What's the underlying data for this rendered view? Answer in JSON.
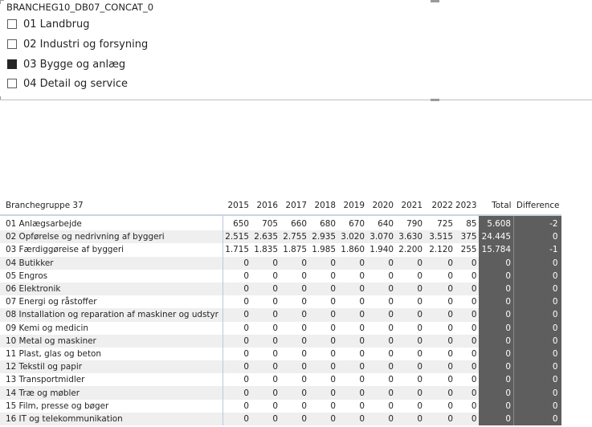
{
  "slicer": {
    "title": "BRANCHEG10_DB07_CONCAT_0",
    "items": [
      {
        "label": "01 Landbrug",
        "checked": false
      },
      {
        "label": "02 Industri og forsyning",
        "checked": false
      },
      {
        "label": "03 Bygge og anlæg",
        "checked": true
      },
      {
        "label": "04 Detail og service",
        "checked": false
      }
    ]
  },
  "matrix": {
    "headers": {
      "row_header": "Branchegruppe 37",
      "years": [
        "2015",
        "2016",
        "2017",
        "2018",
        "2019",
        "2020",
        "2021",
        "2022",
        "2023"
      ],
      "total": "Total",
      "difference": "Difference"
    },
    "rows": [
      {
        "label": "01 Anlægsarbejde",
        "values": [
          "650",
          "705",
          "660",
          "680",
          "670",
          "640",
          "790",
          "725",
          "85"
        ],
        "total": "5.608",
        "diff": "-2"
      },
      {
        "label": "02 Opførelse og nedrivning af byggeri",
        "values": [
          "2.515",
          "2.635",
          "2.755",
          "2.935",
          "3.020",
          "3.070",
          "3.630",
          "3.515",
          "375"
        ],
        "total": "24.445",
        "diff": "0"
      },
      {
        "label": "03 Færdiggøreise af byggeri",
        "values": [
          "1.715",
          "1.835",
          "1.875",
          "1.985",
          "1.860",
          "1.940",
          "2.200",
          "2.120",
          "255"
        ],
        "total": "15.784",
        "diff": "-1"
      },
      {
        "label": "04 Butikker",
        "values": [
          "0",
          "0",
          "0",
          "0",
          "0",
          "0",
          "0",
          "0",
          "0"
        ],
        "total": "0",
        "diff": "0"
      },
      {
        "label": "05 Engros",
        "values": [
          "0",
          "0",
          "0",
          "0",
          "0",
          "0",
          "0",
          "0",
          "0"
        ],
        "total": "0",
        "diff": "0"
      },
      {
        "label": "06 Elektronik",
        "values": [
          "0",
          "0",
          "0",
          "0",
          "0",
          "0",
          "0",
          "0",
          "0"
        ],
        "total": "0",
        "diff": "0"
      },
      {
        "label": "07 Energi og råstoffer",
        "values": [
          "0",
          "0",
          "0",
          "0",
          "0",
          "0",
          "0",
          "0",
          "0"
        ],
        "total": "0",
        "diff": "0"
      },
      {
        "label": "08 Installation og reparation af maskiner og udstyr",
        "values": [
          "0",
          "0",
          "0",
          "0",
          "0",
          "0",
          "0",
          "0",
          "0"
        ],
        "total": "0",
        "diff": "0"
      },
      {
        "label": "09 Kemi og medicin",
        "values": [
          "0",
          "0",
          "0",
          "0",
          "0",
          "0",
          "0",
          "0",
          "0"
        ],
        "total": "0",
        "diff": "0"
      },
      {
        "label": "10 Metal og maskiner",
        "values": [
          "0",
          "0",
          "0",
          "0",
          "0",
          "0",
          "0",
          "0",
          "0"
        ],
        "total": "0",
        "diff": "0"
      },
      {
        "label": "11 Plast, glas og beton",
        "values": [
          "0",
          "0",
          "0",
          "0",
          "0",
          "0",
          "0",
          "0",
          "0"
        ],
        "total": "0",
        "diff": "0"
      },
      {
        "label": "12 Tekstil og papir",
        "values": [
          "0",
          "0",
          "0",
          "0",
          "0",
          "0",
          "0",
          "0",
          "0"
        ],
        "total": "0",
        "diff": "0"
      },
      {
        "label": "13 Transportmidler",
        "values": [
          "0",
          "0",
          "0",
          "0",
          "0",
          "0",
          "0",
          "0",
          "0"
        ],
        "total": "0",
        "diff": "0"
      },
      {
        "label": "14 Træ og møbler",
        "values": [
          "0",
          "0",
          "0",
          "0",
          "0",
          "0",
          "0",
          "0",
          "0"
        ],
        "total": "0",
        "diff": "0"
      },
      {
        "label": "15 Film, presse og bøger",
        "values": [
          "0",
          "0",
          "0",
          "0",
          "0",
          "0",
          "0",
          "0",
          "0"
        ],
        "total": "0",
        "diff": "0"
      },
      {
        "label": "16 IT og telekommunikation",
        "values": [
          "0",
          "0",
          "0",
          "0",
          "0",
          "0",
          "0",
          "0",
          "0"
        ],
        "total": "0",
        "diff": "0"
      }
    ]
  },
  "colors": {
    "total_bg": "#5e5e5e",
    "alt_row_bg": "#efefef",
    "checked_box": "#252423"
  }
}
